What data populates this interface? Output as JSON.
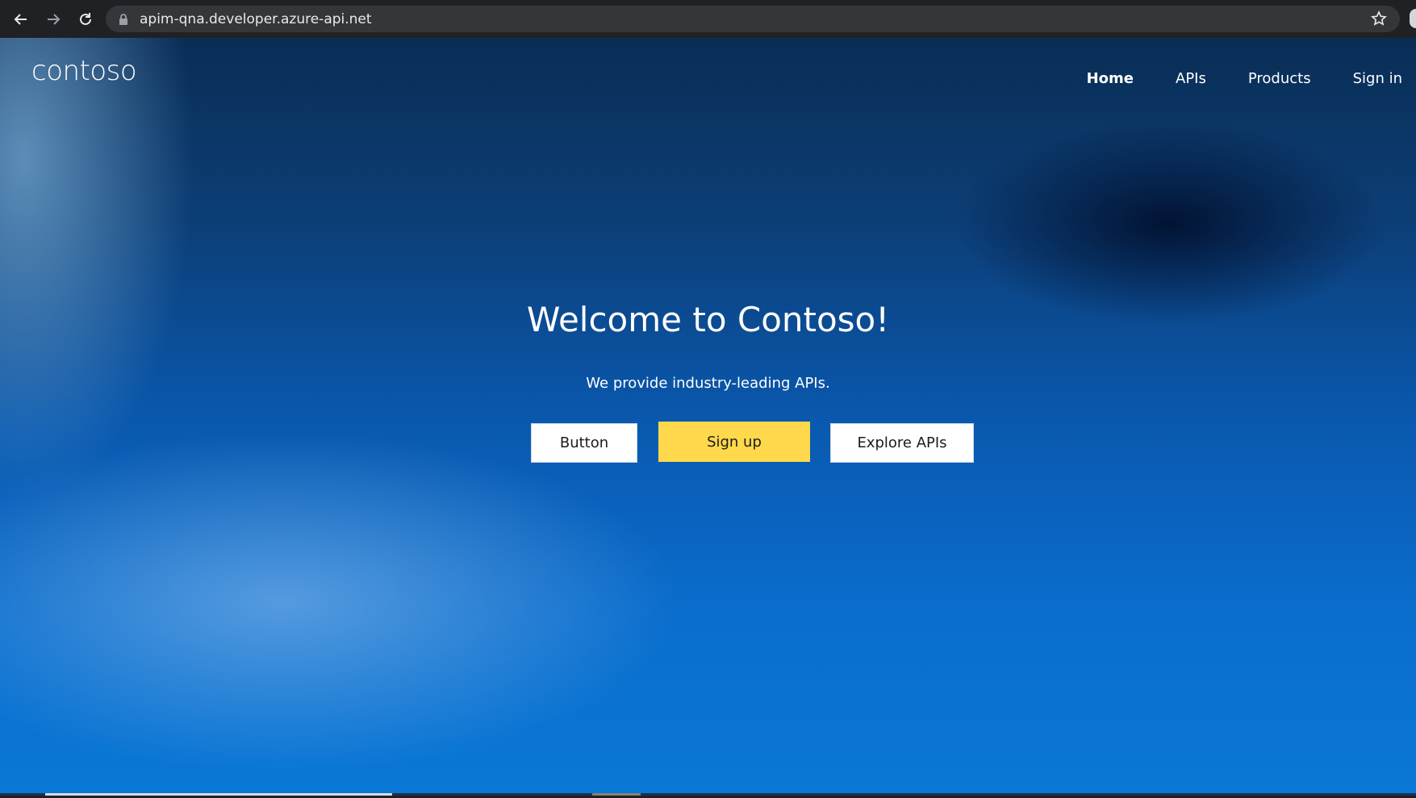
{
  "browser": {
    "url": "apim-qna.developer.azure-api.net"
  },
  "site": {
    "logo": "contoso",
    "nav": [
      {
        "label": "Home",
        "active": true
      },
      {
        "label": "APIs",
        "active": false
      },
      {
        "label": "Products",
        "active": false
      },
      {
        "label": "Sign in",
        "active": false
      }
    ]
  },
  "hero": {
    "title": "Welcome to Contoso!",
    "subtitle": "We provide industry-leading APIs.",
    "buttons": [
      {
        "label": "Button",
        "style": "white"
      },
      {
        "label": "Sign up",
        "style": "yellow"
      },
      {
        "label": "Explore APIs",
        "style": "white"
      }
    ]
  },
  "colors": {
    "accent_yellow": "#ffd84b",
    "browser_bg": "#202124",
    "omnibox_bg": "#35363a"
  },
  "icons": [
    "back-arrow-icon",
    "forward-arrow-icon",
    "reload-icon",
    "lock-icon",
    "star-icon"
  ]
}
